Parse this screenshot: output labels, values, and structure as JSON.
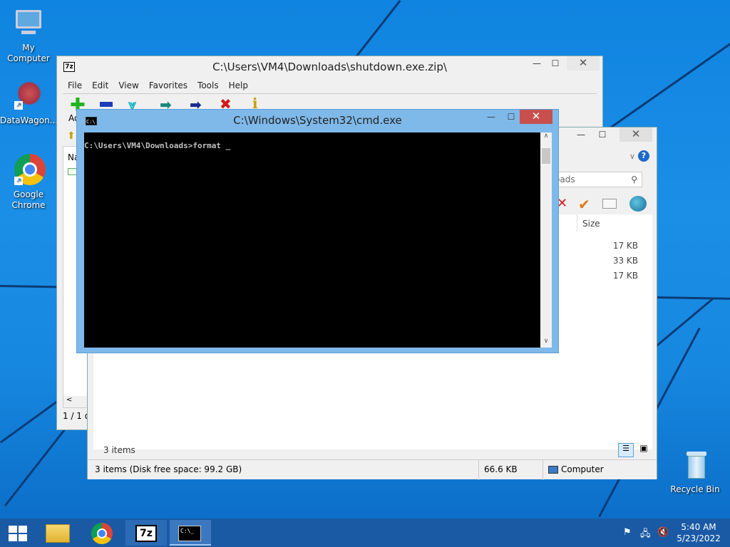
{
  "desktop": {
    "icons": [
      {
        "label": "My Computer"
      },
      {
        "label": "DataWagon..."
      },
      {
        "label": "Google\nChrome"
      },
      {
        "label": "Recycle Bin"
      }
    ]
  },
  "sevenzip": {
    "title": "C:\\Users\\VM4\\Downloads\\shutdown.exe.zip\\",
    "app_icon": "7z",
    "menu": [
      "File",
      "Edit",
      "View",
      "Favorites",
      "Tools",
      "Help"
    ],
    "toolbar_icons": [
      "add-icon",
      "extract-icon",
      "test-icon",
      "copy-icon",
      "move-icon",
      "delete-icon",
      "info-icon"
    ],
    "toolbar_first_label": "Ad",
    "column_name": "Na",
    "status": "1 / 1 o"
  },
  "explorer": {
    "search_placeholder": "oads",
    "column_size": "Size",
    "sizes": [
      "17 KB",
      "33 KB",
      "17 KB"
    ],
    "items_count": "3 items",
    "status_left": "3 items (Disk free space: 99.2 GB)",
    "status_size": "66.6 KB",
    "status_location": "Computer"
  },
  "cmd": {
    "title": "C:\\Windows\\System32\\cmd.exe",
    "app_icon": "C:\\",
    "prompt": "C:\\Users\\VM4\\Downloads>format _"
  },
  "window_buttons": {
    "minimize": "—",
    "maximize": "☐",
    "close": "✕"
  },
  "taskbar": {
    "time": "5:40 AM",
    "date": "5/23/2022",
    "sevenzip_label": "7z",
    "cmd_label": "C:\\_"
  },
  "colors": {
    "accent": "#1a5aa5",
    "close": "#c7504e",
    "cmd_frame": "#7fb9ea"
  }
}
